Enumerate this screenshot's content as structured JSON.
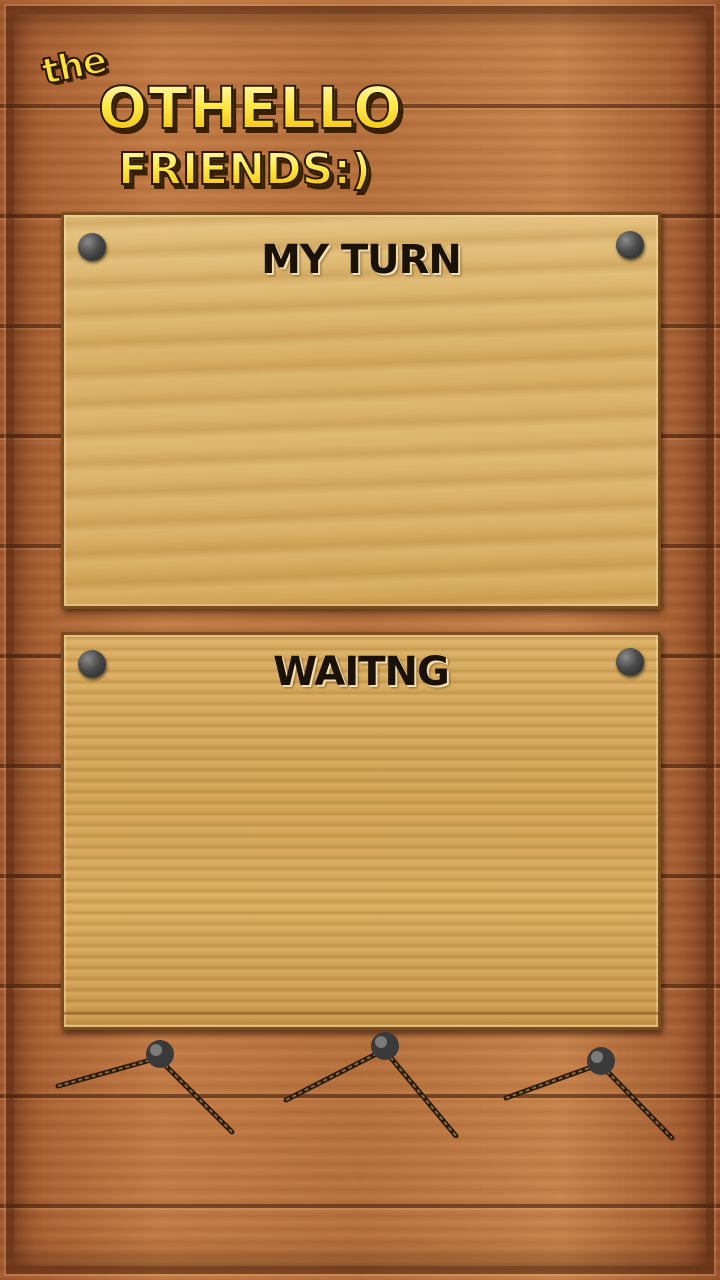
{
  "logo": {
    "line1": "the",
    "line2": "OTHELLO",
    "line3": "FRIENDS:)"
  },
  "panels": {
    "my_turn": {
      "title": "MY TURN"
    },
    "waiting": {
      "title": "WAITNG"
    }
  },
  "hooks": [
    {
      "icon": "nail-hook-icon"
    },
    {
      "icon": "nail-hook-icon"
    },
    {
      "icon": "nail-hook-icon"
    }
  ],
  "colors": {
    "logo_yellow": "#ffe94a",
    "board_light": "#e2be7a",
    "board_dark": "#cfa052",
    "wall": "#b8703a",
    "pin": "#4a4a4a"
  }
}
